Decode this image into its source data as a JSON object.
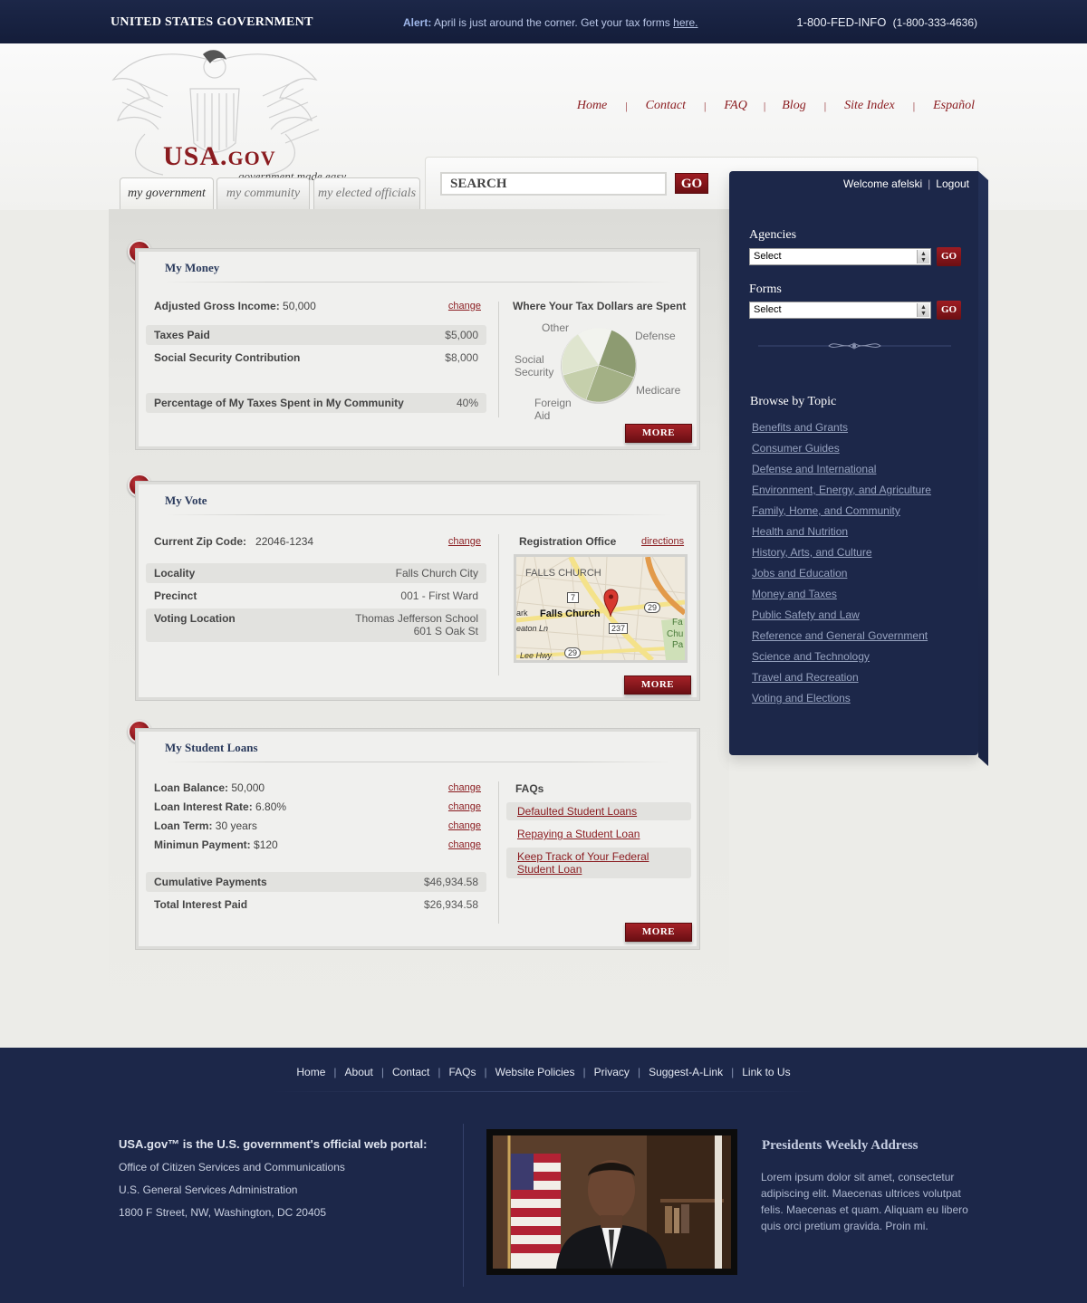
{
  "topbar": {
    "gov_title": "UNITED STATES GOVERNMENT",
    "alert_label": "Alert:",
    "alert_text": "April is just around the corner. Get your tax forms",
    "alert_link": "here.",
    "phone": "1-800-FED-INFO",
    "phone_alt": "(1-800-333-4636)"
  },
  "logo": {
    "main": "USA.",
    "suffix": "GOV",
    "tagline": "government made easy"
  },
  "topnav": [
    "Home",
    "Contact",
    "FAQ",
    "Blog",
    "Site Index",
    "Español"
  ],
  "tabs": [
    "my government",
    "my community",
    "my elected officials"
  ],
  "search": {
    "placeholder": "SEARCH",
    "go": "GO"
  },
  "money": {
    "title": "My Money",
    "agi_label": "Adjusted Gross Income:",
    "agi_value": "50,000",
    "change": "change",
    "rows": [
      {
        "label": "Taxes Paid",
        "value": "$5,000"
      },
      {
        "label": "Social Security Contribution",
        "value": "$8,000"
      },
      {
        "label": "Percentage of My Taxes Spent in My Community",
        "value": "40%"
      }
    ],
    "chart_title": "Where Your Tax Dollars are Spent",
    "more": "MORE"
  },
  "chart_data": {
    "type": "pie",
    "title": "Where Your Tax Dollars are Spent",
    "labels": [
      "Defense",
      "Medicare",
      "Foreign Aid",
      "Social Security",
      "Other"
    ],
    "values": [
      25,
      25,
      15,
      20,
      15
    ],
    "colors": [
      "#8d9b71",
      "#a3b085",
      "#c5cfab",
      "#dfe5cf",
      "#f2f3ee"
    ]
  },
  "vote": {
    "title": "My Vote",
    "zip_label": "Current Zip Code:",
    "zip_value": "22046-1234",
    "change": "change",
    "rows": [
      {
        "label": "Locality",
        "value": "Falls Church City"
      },
      {
        "label": "Precinct",
        "value": "001 - First Ward"
      },
      {
        "label": "Voting Location",
        "value": "Thomas Jefferson School",
        "value2": "601 S Oak St"
      }
    ],
    "office_title": "Registration Office",
    "directions": "directions",
    "map": {
      "area": "FALLS CHURCH",
      "city": "Falls Church",
      "roads": [
        "7",
        "29",
        "237",
        "29"
      ],
      "streets": [
        "ark",
        "eaton Ln",
        "Lee Hwy"
      ],
      "edge": [
        "Fa",
        "Chu",
        "Pa"
      ]
    },
    "more": "MORE"
  },
  "loans": {
    "title": "My Student Loans",
    "change": "change",
    "items": [
      {
        "label": "Loan Balance:",
        "value": "50,000"
      },
      {
        "label": "Loan Interest Rate:",
        "value": "6.80%"
      },
      {
        "label": "Loan Term:",
        "value": "30 years"
      },
      {
        "label": "Minimun Payment:",
        "value": "$120"
      }
    ],
    "rows": [
      {
        "label": "Cumulative Payments",
        "value": "$46,934.58"
      },
      {
        "label": "Total Interest Paid",
        "value": "$26,934.58"
      }
    ],
    "faq_title": "FAQs",
    "faqs": [
      "Defaulted Student Loans",
      "Repaying a Student Loan",
      "Keep Track of Your Federal Student Loan"
    ],
    "more": "MORE"
  },
  "sidebar": {
    "welcome": "Welcome afelski",
    "logout": "Logout",
    "agencies_title": "Agencies",
    "forms_title": "Forms",
    "select_value": "Select",
    "go": "GO",
    "browse_title": "Browse by Topic",
    "topics": [
      "Benefits and Grants",
      "Consumer Guides",
      "Defense and International",
      "Environment, Energy, and Agriculture",
      "Family, Home, and Community",
      "Health and Nutrition",
      "History, Arts, and Culture",
      "Jobs and Education",
      "Money and Taxes",
      "Public Safety and Law",
      "Reference and General Government",
      "Science and Technology",
      "Travel and Recreation",
      "Voting and Elections"
    ]
  },
  "footer": {
    "nav": [
      "Home",
      "About",
      "Contact",
      "FAQs",
      "Website Policies",
      "Privacy",
      "Suggest-A-Link",
      "Link to Us"
    ],
    "info_head": "USA.gov™ is the U.S. government's official web portal:",
    "info_lines": [
      "Office of Citizen Services and Communications",
      "U.S. General Services Administration",
      "1800 F Street, NW, Washington, DC 20405"
    ],
    "address_title": "Presidents Weekly Address",
    "address_text": "Lorem ipsum dolor sit amet, consectetur adipiscing elit. Maecenas ultrices volutpat felis. Maecenas et quam. Aliquam eu libero quis orci pretium gravida. Proin mi."
  },
  "colors": {
    "navy": "#1c2749",
    "brand_red": "#8a1b1f",
    "panel": "#f0f0ee"
  }
}
